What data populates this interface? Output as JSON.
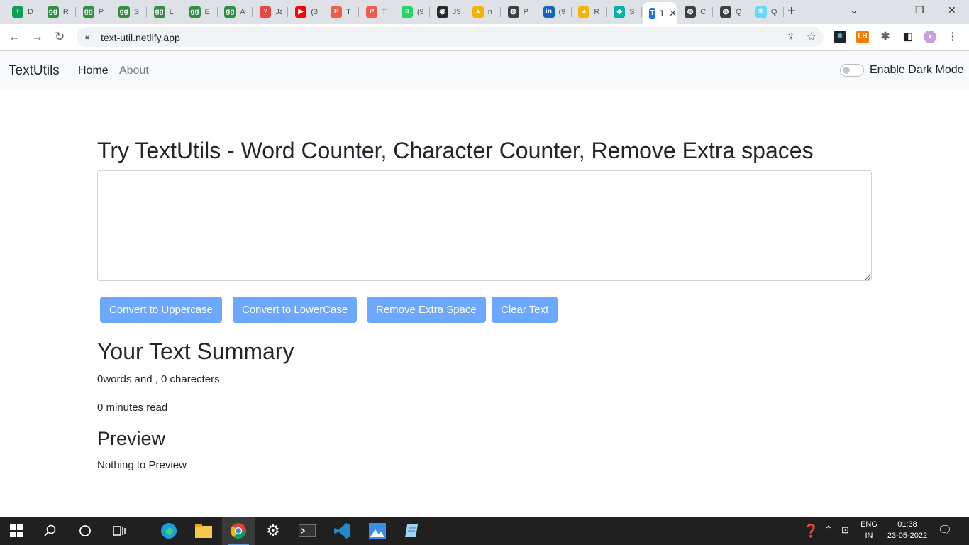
{
  "browser": {
    "tabs": [
      {
        "title": "D",
        "icon_color": "#0f9d58",
        "icon_glyph": "+"
      },
      {
        "title": "R",
        "icon_color": "#2f8d46",
        "icon_glyph": "gg"
      },
      {
        "title": "P",
        "icon_color": "#2f8d46",
        "icon_glyph": "gg"
      },
      {
        "title": "S",
        "icon_color": "#2f8d46",
        "icon_glyph": "gg"
      },
      {
        "title": "L",
        "icon_color": "#2f8d46",
        "icon_glyph": "gg"
      },
      {
        "title": "E",
        "icon_color": "#2f8d46",
        "icon_glyph": "gg"
      },
      {
        "title": "A",
        "icon_color": "#2f8d46",
        "icon_glyph": "gg"
      },
      {
        "title": "Ja",
        "icon_color": "#e84545",
        "icon_glyph": "?"
      },
      {
        "title": "(3",
        "icon_color": "#ff0000",
        "icon_glyph": "▶"
      },
      {
        "title": "T",
        "icon_color": "#f15b4a",
        "icon_glyph": "P"
      },
      {
        "title": "T",
        "icon_color": "#f15b4a",
        "icon_glyph": "P"
      },
      {
        "title": "(9",
        "icon_color": "#25d366",
        "icon_glyph": "9"
      },
      {
        "title": "JS",
        "icon_color": "#24292e",
        "icon_glyph": "◉"
      },
      {
        "title": "n",
        "icon_color": "#f4b400",
        "icon_glyph": "▲"
      },
      {
        "title": "P",
        "icon_color": "#3c4043",
        "icon_glyph": "◍"
      },
      {
        "title": "(9",
        "icon_color": "#0a66c2",
        "icon_glyph": "in"
      },
      {
        "title": "R",
        "icon_color": "#f4b400",
        "icon_glyph": "▲"
      },
      {
        "title": "S",
        "icon_color": "#00b2a9",
        "icon_glyph": "◆"
      },
      {
        "title": "T",
        "icon_color": "#1a73e8",
        "icon_glyph": "T",
        "active": true
      },
      {
        "title": "C",
        "icon_color": "#3c4043",
        "icon_glyph": "◍"
      },
      {
        "title": "Q",
        "icon_color": "#3c4043",
        "icon_glyph": "◍"
      },
      {
        "title": "Q",
        "icon_color": "#61dafb",
        "icon_glyph": "⚛"
      }
    ],
    "url": "text-util.netlify.app"
  },
  "navbar": {
    "brand": "TextUtils",
    "links": [
      "Home",
      "About"
    ],
    "dark_mode_label": "Enable Dark Mode"
  },
  "main": {
    "heading": "Try TextUtils - Word Counter, Character Counter, Remove Extra spaces",
    "textarea_value": "",
    "buttons": [
      "Convert to Uppercase",
      "Convert to LowerCase",
      "Remove Extra Space",
      "Clear Text"
    ],
    "summary_heading": "Your Text Summary",
    "summary_counts": "0words and , 0 charecters",
    "read_time": "0 minutes read",
    "preview_heading": "Preview",
    "preview_text": "Nothing to Preview"
  },
  "taskbar": {
    "lang_top": "ENG",
    "lang_bottom": "IN",
    "time": "01:38",
    "date": "23-05-2022"
  },
  "colors": {
    "button_bg": "#6ea8fe",
    "navbar_bg": "#f8f9fa",
    "taskbar_bg": "#202020"
  }
}
